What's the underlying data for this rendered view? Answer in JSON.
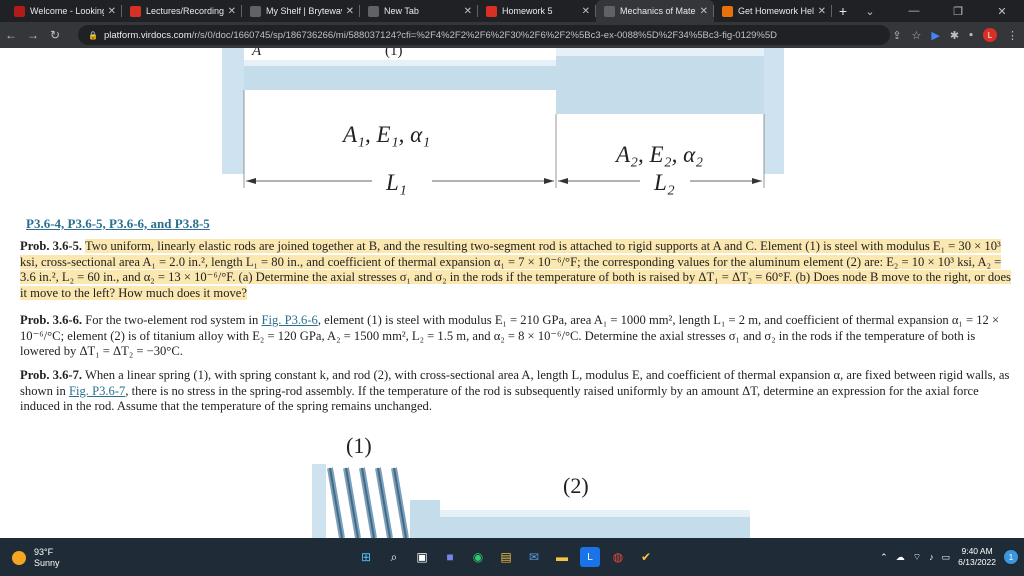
{
  "tabs": [
    {
      "label": "Welcome - LookingGl",
      "icon": "lookingglass-icon",
      "color": "#b31b1b",
      "active": false
    },
    {
      "label": "Lectures/Recordings",
      "icon": "gear-icon",
      "color": "#d93025",
      "active": false
    },
    {
      "label": "My Shelf | Brytewave",
      "icon": "document-icon",
      "color": "#5f6368",
      "active": false
    },
    {
      "label": "New Tab",
      "icon": "chrome-icon",
      "color": "#5f6368",
      "active": false
    },
    {
      "label": "Homework 5",
      "icon": "gear-icon",
      "color": "#d93025",
      "active": false
    },
    {
      "label": "Mechanics of Materia",
      "icon": "document-icon",
      "color": "#5f6368",
      "active": true
    },
    {
      "label": "Get Homework Help",
      "icon": "chegg-icon",
      "color": "#e8710a",
      "active": false
    }
  ],
  "address": {
    "host": "platform.virdocs.com",
    "path": "/r/s/0/doc/1660745/sp/186736266/mi/588037124?cfi=%2F4%2F2%2F6%2F30%2F6%2F2%5Bc3-ex-0088%5D%2F34%5Bc3-fig-0129%5D",
    "avatar_letter": "L"
  },
  "figure_top": {
    "rod1_label": "A₁, E₁, α₁",
    "rod2_label": "A₂, E₂, α₂",
    "L1": "L₁",
    "L2": "L₂",
    "partial_A": "A",
    "partial_1": "(1)"
  },
  "links_label": "P3.6-4, P3.6-5, P3.6-6, and P3.8-5",
  "prob5": {
    "head": "Prob. 3.6-5.",
    "text": "Two uniform, linearly elastic rods are joined together at B, and the resulting two-segment rod is attached to rigid supports at A and C. Element (1) is steel with modulus E₁ = 30 × 10³ ksi, cross-sectional area A₁ = 2.0 in.², length L₁ = 80 in., and coefficient of thermal expansion α₁ = 7 × 10⁻⁶/°F; the corresponding values for the aluminum element (2) are: E₂ = 10 × 10³ ksi, A₂ = 3.6 in.², L₂ = 60 in., and α₂ = 13 × 10⁻⁶/°F. (a) Determine the axial stresses σ₁ and σ₂ in the rods if the temperature of both is raised by ΔT₁ = ΔT₂ = 60°F. (b) Does node B move to the right, or does it move to the left? How much does it move?"
  },
  "prob6": {
    "head": "Prob. 3.6-6.",
    "pre": "For the two-element rod system in",
    "link": "Fig. P3.6-6",
    "post": ", element (1) is steel with modulus E₁ = 210 GPa, area A₁ = 1000 mm², length L₁ = 2 m, and coefficient of thermal expansion α₁ = 12 × 10⁻⁶/°C; element (2) is of titanium alloy with E₂ = 120 GPa, A₂ = 1500 mm², L₂ = 1.5 m, and α₂ = 8 × 10⁻⁶/°C. Determine the axial stresses σ₁ and σ₂ in the rods if the temperature of both is lowered by ΔT₁ = ΔT₂ = −30°C."
  },
  "prob7": {
    "head": "Prob. 3.6-7.",
    "pre": "When a linear spring (1), with spring constant k, and rod (2), with cross-sectional area A, length L, modulus E, and coefficient of thermal expansion α, are fixed between rigid walls, as shown in",
    "link": "Fig. P3.6-7",
    "post": ", there is no stress in the spring-rod assembly. If the temperature of the rod is subsequently raised uniformly by an amount ΔT, determine an expression for the axial force induced in the rod. Assume that the temperature of the spring remains unchanged."
  },
  "figure_bottom": {
    "label1": "(1)",
    "label2": "(2)"
  },
  "taskbar": {
    "temp": "93°F",
    "weather": "Sunny",
    "time": "9:40 AM",
    "date": "6/13/2022",
    "notif_count": "1"
  }
}
